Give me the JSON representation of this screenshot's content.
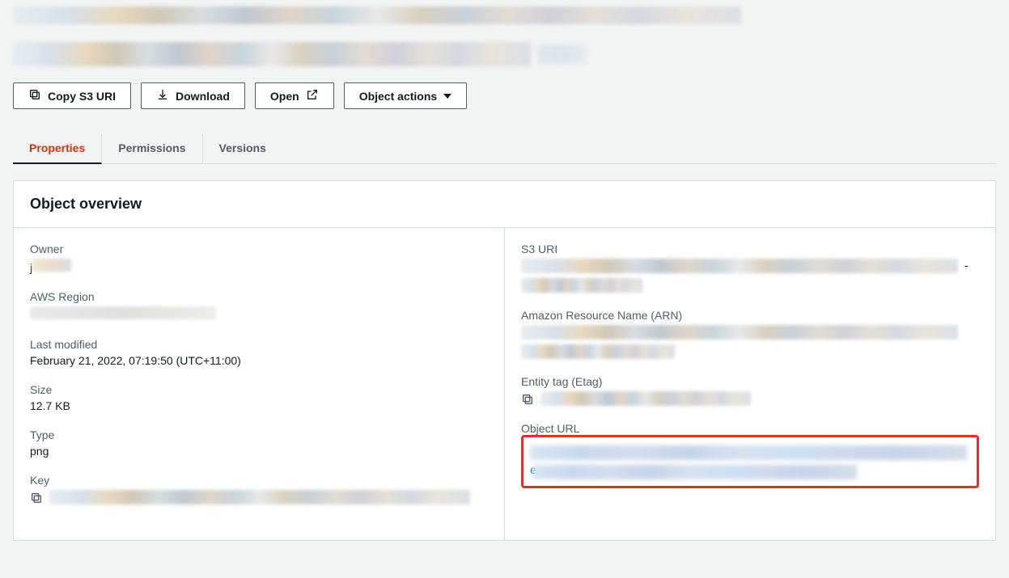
{
  "toolbar": {
    "copy_s3_uri": "Copy S3 URI",
    "download": "Download",
    "open": "Open",
    "object_actions": "Object actions"
  },
  "tabs": {
    "properties": "Properties",
    "permissions": "Permissions",
    "versions": "Versions"
  },
  "overview": {
    "title": "Object overview",
    "labels": {
      "owner": "Owner",
      "aws_region": "AWS Region",
      "last_modified": "Last modified",
      "size": "Size",
      "type": "Type",
      "key": "Key",
      "s3_uri": "S3 URI",
      "arn": "Amazon Resource Name (ARN)",
      "etag": "Entity tag (Etag)",
      "object_url": "Object URL"
    },
    "values": {
      "last_modified": "February 21, 2022, 07:19:50 (UTC+11:00)",
      "size": "12.7 KB",
      "type": "png"
    }
  }
}
